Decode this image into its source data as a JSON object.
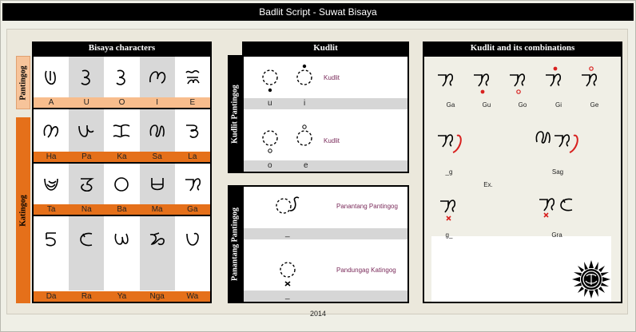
{
  "title": "Badlit  Script - Suwat Bisaya",
  "year": "2014",
  "bisaya": {
    "header": "Bisaya characters",
    "pantingog_label": "Pantingog",
    "katingog_label": "Katingog",
    "vowels": [
      "A",
      "U",
      "O",
      "I",
      "E"
    ],
    "row1": [
      "Ha",
      "Pa",
      "Ka",
      "Sa",
      "La"
    ],
    "row2": [
      "Ta",
      "Na",
      "Ba",
      "Ma",
      "Ga"
    ],
    "row3": [
      "Da",
      "Ra",
      "Ya",
      "Nga",
      "Wa"
    ]
  },
  "kudlit": {
    "header": "Kudlit",
    "side_label": "Kudlit Pantingog",
    "label_top": "Kudlit",
    "label_bottom": "Kudlit",
    "row1": [
      "u",
      "i"
    ],
    "row2": [
      "o",
      "e"
    ]
  },
  "panantang": {
    "side_label": "Panantang Pantingog",
    "item1": "Panantang Pantingog",
    "item1_value": "_",
    "item2": "Pandungag Katingog",
    "item2_value": "_"
  },
  "combinations": {
    "header": "Kudlit and its combinations",
    "row1": [
      "Ga",
      "Gu",
      "Go",
      "Gi",
      "Ge"
    ],
    "g_suffix": "_g",
    "sag": "Sag",
    "ex": "Ex.",
    "g_prefix": "g_",
    "gra": "Gra"
  },
  "colors": {
    "accent_orange": "#e5701a",
    "peach": "#f8bd8d",
    "kudlit_red": "#d8211f"
  }
}
